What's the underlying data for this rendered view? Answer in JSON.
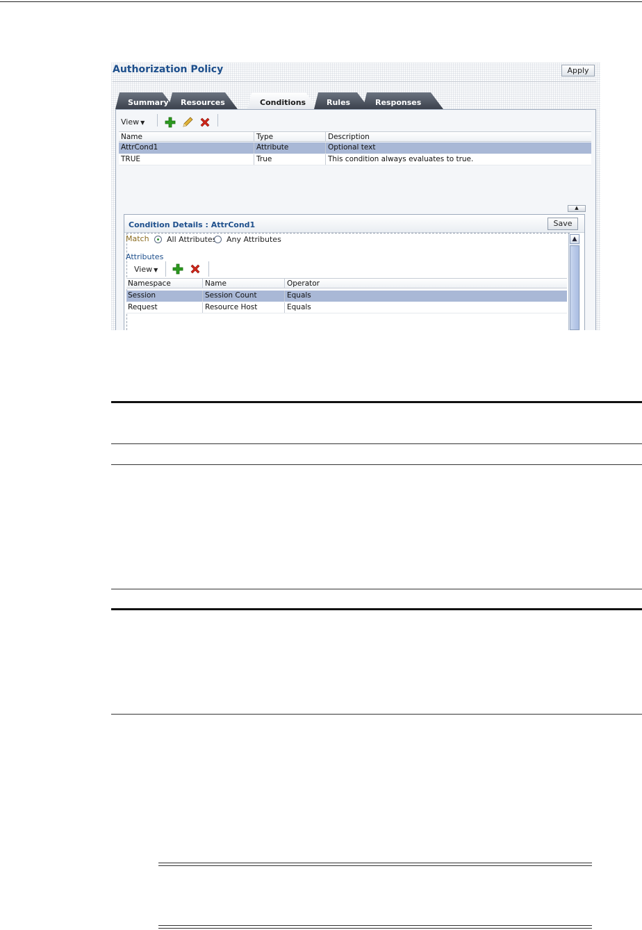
{
  "policy": {
    "title": "Authorization Policy",
    "apply_label": "Apply"
  },
  "tabs": [
    {
      "label": "Summary",
      "active": false
    },
    {
      "label": "Resources",
      "active": false
    },
    {
      "label": "Conditions",
      "active": true
    },
    {
      "label": "Rules",
      "active": false
    },
    {
      "label": "Responses",
      "active": false
    }
  ],
  "conditions": {
    "view_label": "View",
    "columns": [
      "Name",
      "Type",
      "Description"
    ],
    "rows": [
      {
        "name": "AttrCond1",
        "type": "Attribute",
        "description": "Optional text",
        "selected": true
      },
      {
        "name": "TRUE",
        "type": "True",
        "description": "This condition always evaluates to true.",
        "selected": false
      }
    ],
    "icons": {
      "add": "add-icon",
      "edit": "edit-pencil-icon",
      "delete": "delete-icon"
    }
  },
  "details": {
    "title": "Condition Details : AttrCond1",
    "save_label": "Save",
    "match_label": "Match",
    "match_options": [
      {
        "label": "All Attributes",
        "selected": true
      },
      {
        "label": "Any Attributes",
        "selected": false
      }
    ],
    "attributes_label": "Attributes",
    "view_label": "View",
    "columns": [
      "Namespace",
      "Name",
      "Operator"
    ],
    "rows": [
      {
        "namespace": "Session",
        "name": "Session Count",
        "operator": "Equals",
        "selected": true
      },
      {
        "namespace": "Request",
        "name": "Resource Host",
        "operator": "Equals",
        "selected": false
      }
    ]
  },
  "colors": {
    "accent": "#1d4f8c",
    "selection": "#a9b8d6",
    "add_green": "#2c9a1f",
    "delete_red": "#d0261a"
  }
}
